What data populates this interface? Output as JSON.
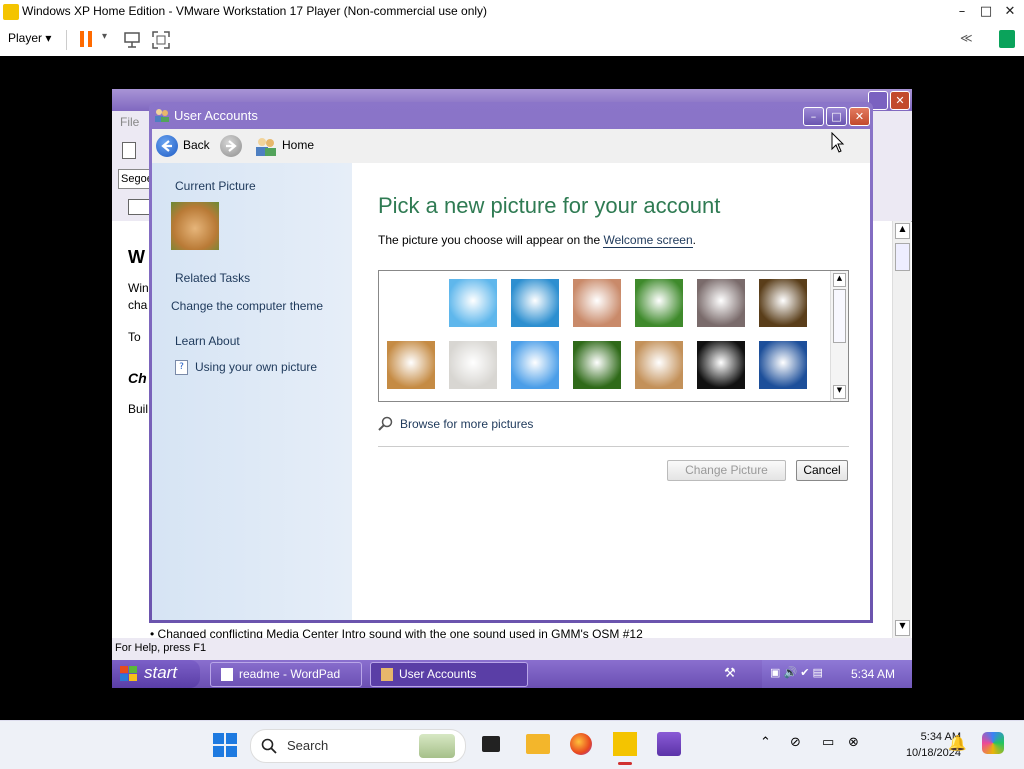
{
  "host": {
    "title": "Windows XP Home Edition - VMware Workstation 17 Player (Non-commercial use only)",
    "player_label": "Player",
    "minimize": "–",
    "maximize": "□",
    "close": "✕"
  },
  "wordpad": {
    "menu_file": "File",
    "font_box": "Segoe",
    "doc_heading": "W",
    "doc_line1": "Win",
    "doc_line2": "cha",
    "doc_line3": "To",
    "doc_subheading": "Ch",
    "doc_line4": "Buil",
    "doc_bottom": "•    Changed conflicting Media Center Intro sound with the one sound used in GMM's OSM #12",
    "status": "For Help, press F1"
  },
  "dialog": {
    "title": "User Accounts",
    "back_label": "Back",
    "home_label": "Home",
    "sidebar": {
      "current_picture": "Current Picture",
      "related_tasks": "Related Tasks",
      "change_theme": "Change the computer theme",
      "learn_about": "Learn About",
      "own_picture": "Using your own picture"
    },
    "heading": "Pick a new picture for your account",
    "description": "The picture you choose will appear on the ",
    "welcome_link": "Welcome screen",
    "description_end": ".",
    "pictures": [
      {
        "name": "soccer-ball",
        "color": "#ffffff"
      },
      {
        "name": "beach-ball",
        "color": "#5fb7ec"
      },
      {
        "name": "sailboat",
        "color": "#2d8fd0"
      },
      {
        "name": "book",
        "color": "#c98a6a"
      },
      {
        "name": "butterfly",
        "color": "#3f8a2c"
      },
      {
        "name": "cat",
        "color": "#7a6b6b"
      },
      {
        "name": "chess",
        "color": "#5a3e1a"
      },
      {
        "name": "dog",
        "color": "#c58b44"
      },
      {
        "name": "fan",
        "color": "#d8d6d2"
      },
      {
        "name": "goldfish",
        "color": "#4b9ee8"
      },
      {
        "name": "grass",
        "color": "#2f6a19"
      },
      {
        "name": "guitar",
        "color": "#c3915a"
      },
      {
        "name": "flower",
        "color": "#111111"
      },
      {
        "name": "bridge",
        "color": "#1d4f9a"
      }
    ],
    "browse": "Browse for more pictures",
    "change_button": "Change Picture",
    "cancel_button": "Cancel"
  },
  "xp_taskbar": {
    "start": "start",
    "task1": "readme - WordPad",
    "task2": "User Accounts",
    "clock": "5:34 AM"
  },
  "w11_taskbar": {
    "search": "Search",
    "time": "5:34 AM",
    "date": "10/18/2024"
  },
  "colors": {
    "xp_purple": "#7a62c0",
    "heading_green": "#2f7b53",
    "link_blue": "#1e395b",
    "vmware_orange": "#ff6a00"
  }
}
